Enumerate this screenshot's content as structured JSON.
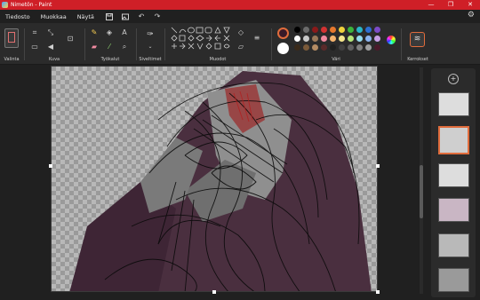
{
  "window": {
    "title": "Nimetön - Paint",
    "controls": [
      "—",
      "❐",
      "✕"
    ]
  },
  "menu": {
    "items": [
      "Tiedosto",
      "Muokkaa",
      "Näytä"
    ]
  },
  "ribbon": {
    "groups": {
      "selection": "Valinta",
      "image": "Kuva",
      "tools": "Työkalut",
      "brushes": "Siveltimet",
      "shapes": "Muodot",
      "colors": "Väri",
      "layers": "Kerrokset"
    }
  },
  "colors": {
    "accent": "#e06c3c",
    "titlebar": "#cf1f27",
    "palette": [
      "#000000",
      "#6b6b6b",
      "#8a1a1a",
      "#d23232",
      "#e6782d",
      "#f0d23c",
      "#3cb43c",
      "#29b6c8",
      "#2d6ed2",
      "#7d4bc8",
      "#ffffff",
      "#c8c8c8",
      "#9b7a5a",
      "#f08aa0",
      "#f5b46e",
      "#f5e68c",
      "#b4e678",
      "#96dcf0",
      "#8cb4f0",
      "#c8a0e6",
      "#3a2a1a",
      "#7a5a3a",
      "#b48c64",
      "#5a2a2a",
      "#202020",
      "#404040",
      "#606060",
      "#808080",
      "#a0a0a0",
      "#4a1a2a"
    ]
  },
  "layers_panel": {
    "add_label": "+"
  }
}
